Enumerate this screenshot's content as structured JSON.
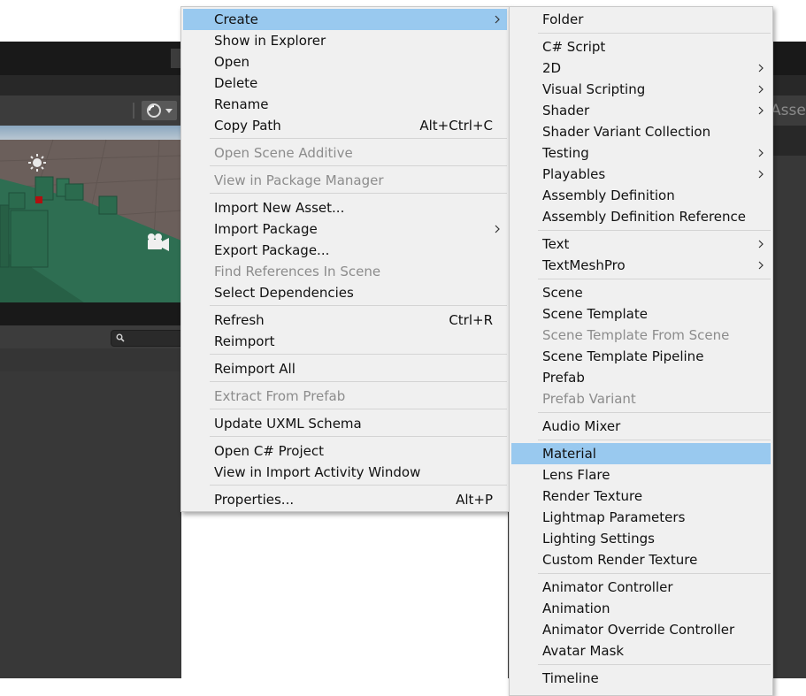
{
  "editor": {
    "scene_toolbar_right_label": "Asse"
  },
  "context_menu": {
    "items": [
      {
        "label": "Create",
        "has_submenu": true,
        "highlighted": true
      },
      {
        "label": "Show in Explorer"
      },
      {
        "label": "Open"
      },
      {
        "label": "Delete"
      },
      {
        "label": "Rename"
      },
      {
        "label": "Copy Path",
        "shortcut": "Alt+Ctrl+C"
      },
      {
        "label": "Open Scene Additive",
        "disabled": true
      },
      {
        "label": "View in Package Manager",
        "disabled": true
      },
      {
        "label": "Import New Asset..."
      },
      {
        "label": "Import Package",
        "has_submenu": true
      },
      {
        "label": "Export Package..."
      },
      {
        "label": "Find References In Scene",
        "disabled": true
      },
      {
        "label": "Select Dependencies"
      },
      {
        "label": "Refresh",
        "shortcut": "Ctrl+R"
      },
      {
        "label": "Reimport"
      },
      {
        "label": "Reimport All"
      },
      {
        "label": "Extract From Prefab",
        "disabled": true
      },
      {
        "label": "Update UXML Schema"
      },
      {
        "label": "Open C# Project"
      },
      {
        "label": "View in Import Activity Window"
      },
      {
        "label": "Properties...",
        "shortcut": "Alt+P"
      }
    ]
  },
  "create_submenu": {
    "items": [
      {
        "label": "Folder"
      },
      {
        "label": "C# Script"
      },
      {
        "label": "2D",
        "has_submenu": true
      },
      {
        "label": "Visual Scripting",
        "has_submenu": true
      },
      {
        "label": "Shader",
        "has_submenu": true
      },
      {
        "label": "Shader Variant Collection"
      },
      {
        "label": "Testing",
        "has_submenu": true
      },
      {
        "label": "Playables",
        "has_submenu": true
      },
      {
        "label": "Assembly Definition"
      },
      {
        "label": "Assembly Definition Reference"
      },
      {
        "label": "Text",
        "has_submenu": true
      },
      {
        "label": "TextMeshPro",
        "has_submenu": true
      },
      {
        "label": "Scene"
      },
      {
        "label": "Scene Template"
      },
      {
        "label": "Scene Template From Scene",
        "disabled": true
      },
      {
        "label": "Scene Template Pipeline"
      },
      {
        "label": "Prefab"
      },
      {
        "label": "Prefab Variant",
        "disabled": true
      },
      {
        "label": "Audio Mixer"
      },
      {
        "label": "Material",
        "highlighted": true
      },
      {
        "label": "Lens Flare"
      },
      {
        "label": "Render Texture"
      },
      {
        "label": "Lightmap Parameters"
      },
      {
        "label": "Lighting Settings"
      },
      {
        "label": "Custom Render Texture"
      },
      {
        "label": "Animator Controller"
      },
      {
        "label": "Animation"
      },
      {
        "label": "Animator Override Controller"
      },
      {
        "label": "Avatar Mask"
      },
      {
        "label": "Timeline"
      }
    ]
  },
  "colors": {
    "menu_bg": "#f0f0f0",
    "highlight": "#99c9ef",
    "disabled_text": "#8c8c8c",
    "editor_dark": "#383838",
    "scene_ground": "#2e6e52"
  },
  "icons": {
    "gizmo": "sphere-gizmo-icon",
    "sun": "directional-light-icon",
    "camera": "camera-icon",
    "search": "search-icon",
    "submenu": "chevron-right-icon"
  }
}
